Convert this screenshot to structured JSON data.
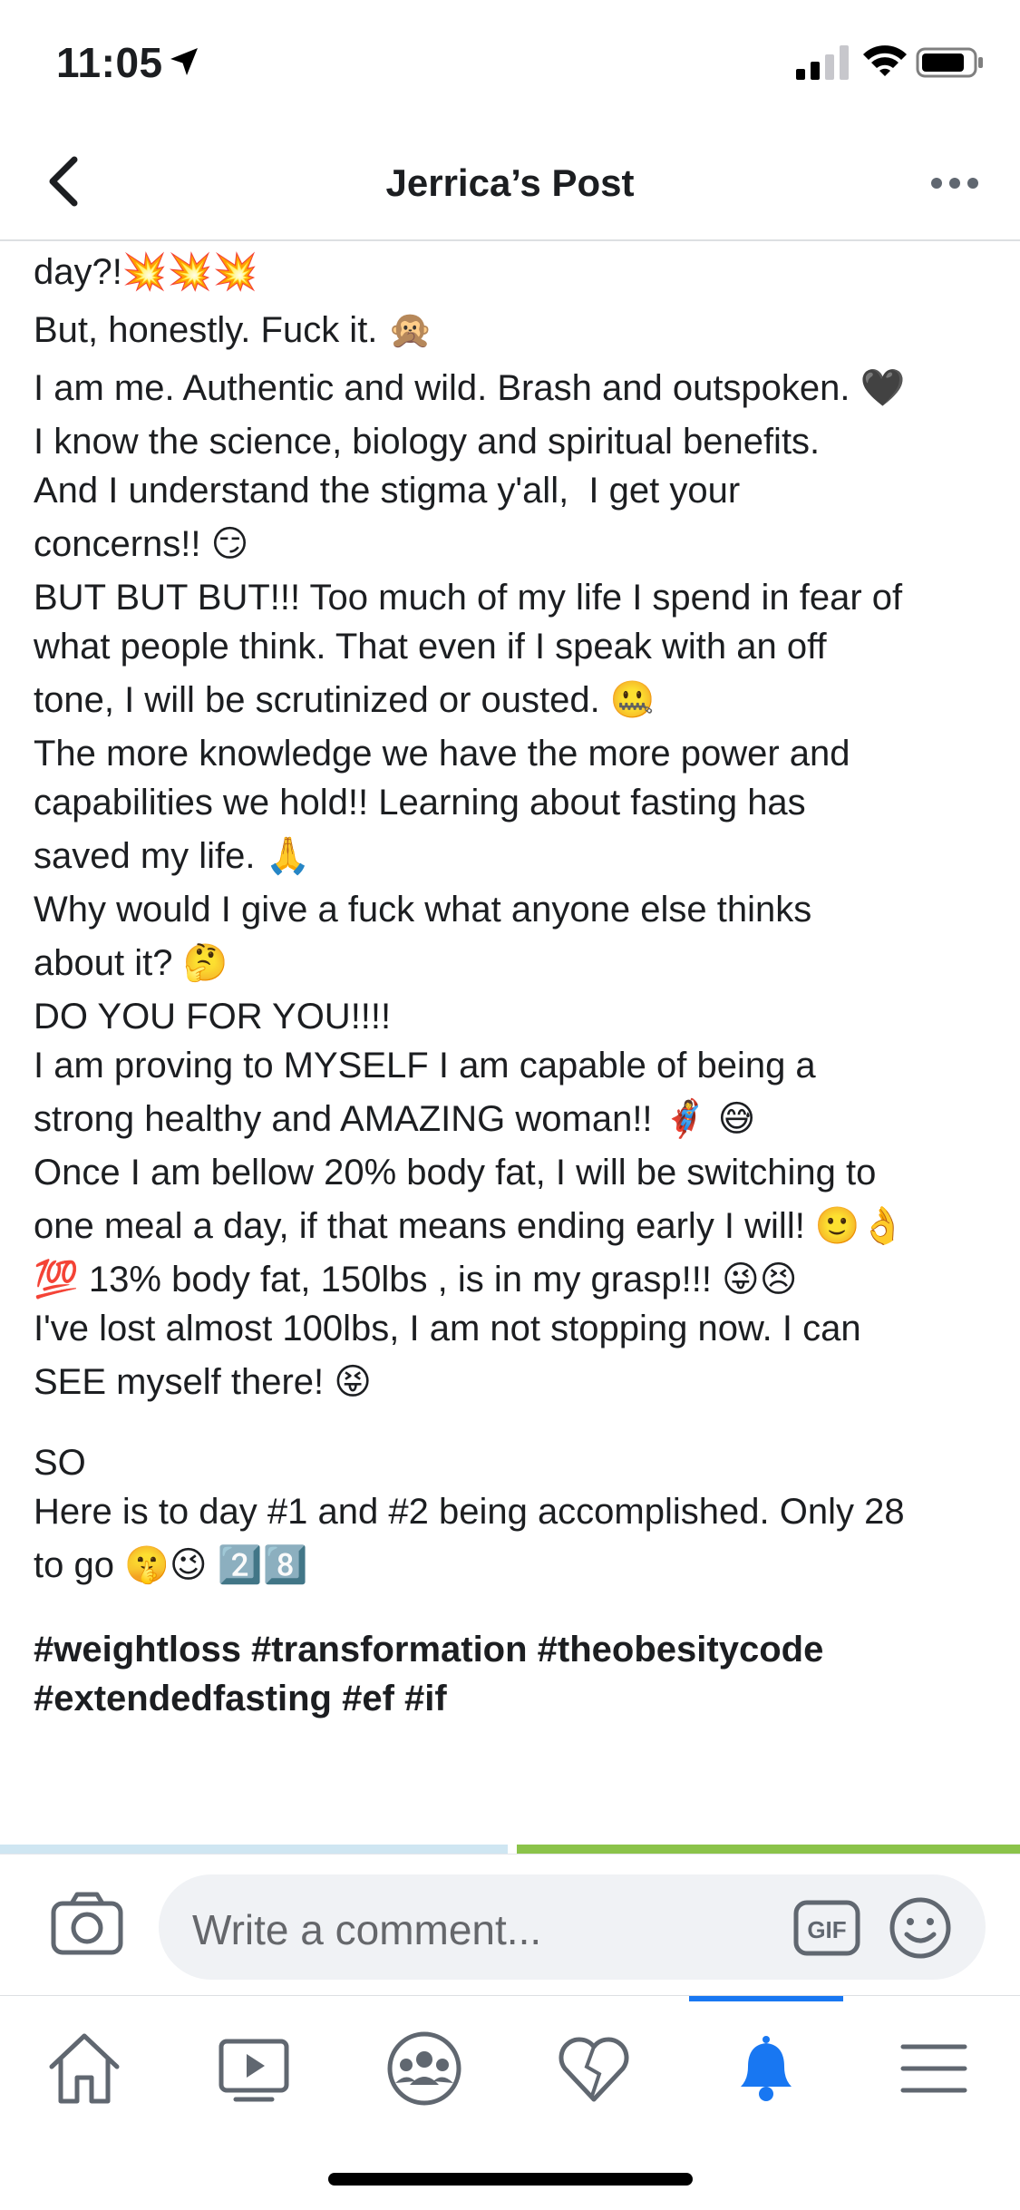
{
  "status_bar": {
    "time": "11:05"
  },
  "header": {
    "title": "Jerrica’s Post"
  },
  "post": {
    "lines": [
      "day?!💥💥💥",
      "But, honestly. Fuck it. 🙊",
      "I am me. Authentic and wild. Brash and outspoken. 🖤",
      "I know the science, biology and spiritual benefits.",
      "And I understand the stigma y'all,  I get your",
      "concerns!! 😏",
      "BUT BUT BUT!!! Too much of my life I spend in fear of",
      "what people think. That even if I speak with an off",
      "tone, I will be scrutinized or ousted. 🤐",
      "The more knowledge we have the more power and",
      "capabilities we hold!! Learning about fasting has",
      "saved my life. 🙏",
      "Why would I give a fuck what anyone else thinks",
      "about it? 🤔",
      "DO YOU FOR YOU!!!!",
      "I am proving to MYSELF I am capable of being a",
      "strong healthy and AMAZING woman!! 🦸‍♀️ 😅",
      "Once I am bellow 20% body fat, I will be switching to",
      "one meal a day, if that means ending early I will! 🙂👌",
      "💯 13% body fat, 150lbs , is in my grasp!!! 😜😣",
      "I've lost almost 100lbs, I am not stopping now. I can",
      "SEE myself there! 😝",
      "SO",
      "Here is to day #1 and #2 being accomplished. Only 28",
      "to go 🤫😉 2️⃣8️⃣"
    ],
    "hashtags_line1": "#weightloss #transformation #theobesitycode",
    "hashtags_line2": "#extendedfasting #ef #if"
  },
  "comment_bar": {
    "placeholder": "Write a comment...",
    "gif_label": "GIF"
  },
  "tabs": [
    {
      "name": "home",
      "icon": "home-icon"
    },
    {
      "name": "watch",
      "icon": "video-play-icon"
    },
    {
      "name": "groups",
      "icon": "groups-icon"
    },
    {
      "name": "dating",
      "icon": "heart-icon"
    },
    {
      "name": "notifications",
      "icon": "bell-icon",
      "active": true
    },
    {
      "name": "menu",
      "icon": "hamburger-menu-icon"
    }
  ],
  "colors": {
    "accent": "#1877f2",
    "text": "#1c1e21",
    "secondary_text": "#65676b",
    "input_bg": "#f0f2f5"
  }
}
